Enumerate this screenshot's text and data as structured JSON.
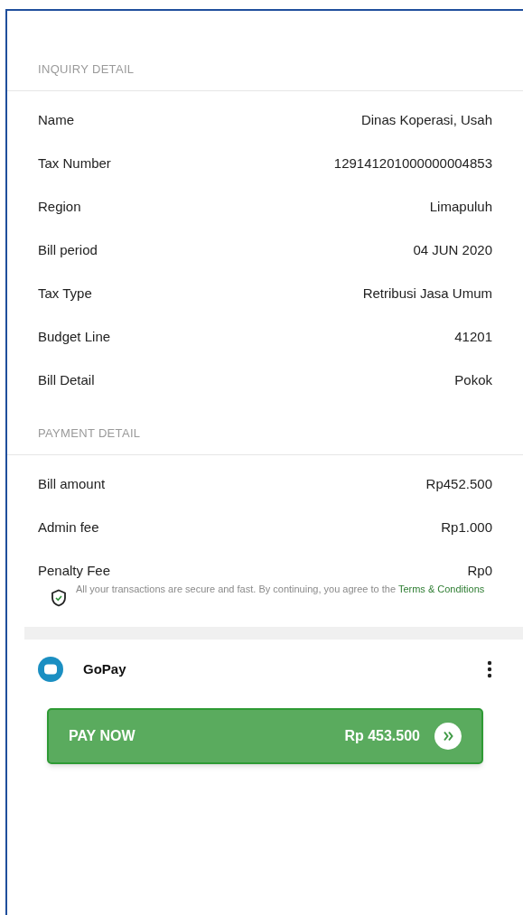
{
  "inquiry": {
    "title": "INQUIRY DETAIL",
    "rows": [
      {
        "label": "Name",
        "value": "Dinas Koperasi, Usah"
      },
      {
        "label": "Tax Number",
        "value": "129141201000000004853"
      },
      {
        "label": "Region",
        "value": "Limapuluh"
      },
      {
        "label": "Bill period",
        "value": "04 JUN 2020"
      },
      {
        "label": "Tax Type",
        "value": "Retribusi Jasa Umum"
      },
      {
        "label": "Budget Line",
        "value": "41201"
      },
      {
        "label": "Bill Detail",
        "value": "Pokok"
      }
    ]
  },
  "payment": {
    "title": "PAYMENT DETAIL",
    "rows": [
      {
        "label": "Bill amount",
        "value": "Rp452.500"
      },
      {
        "label": "Admin fee",
        "value": "Rp1.000"
      },
      {
        "label": "Penalty Fee",
        "value": "Rp0"
      }
    ]
  },
  "notice": {
    "text": "All your transactions are secure and fast. By continuing, you agree to the",
    "link": "Terms & Conditions"
  },
  "method": {
    "name": "GoPay"
  },
  "pay_button": {
    "label": "PAY NOW",
    "amount": "Rp 453.500"
  }
}
